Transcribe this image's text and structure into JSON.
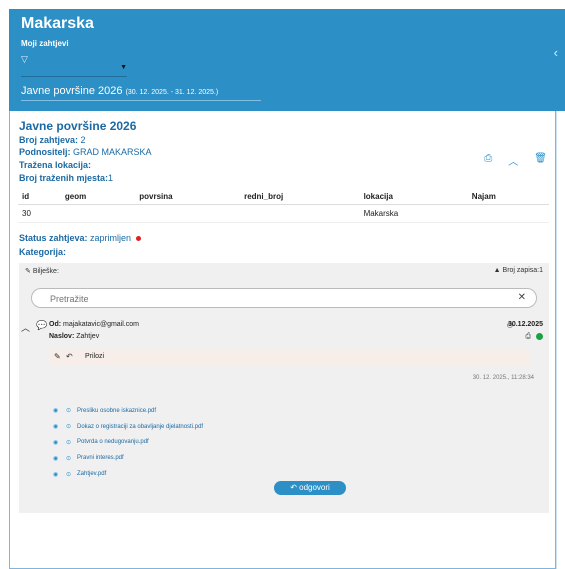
{
  "header": {
    "title": "Makarska",
    "subtitle": "Moji zahtjevi",
    "filter_icon": "filter-icon",
    "select_value": "",
    "collapse_icon": "chevron-left-icon",
    "range_title": "Javne površine 2026",
    "range_dates": "(30. 12. 2025. - 31. 12. 2025.)"
  },
  "request": {
    "title": "Javne površine 2026",
    "broj_label": "Broj zahtjeva:",
    "broj_value": "2",
    "podnositelj_label": "Podnositelj:",
    "podnositelj_value": "GRAD MAKARSKA",
    "lokacija_label": "Tražena lokacija:",
    "mjesta_label": "Broj traženih mjesta:",
    "mjesta_value": "1",
    "status_label": "Status zahtjeva:",
    "status_value": "zaprimljen",
    "kategorija_label": "Kategorija:"
  },
  "table": {
    "headers": [
      "id",
      "geom",
      "povrsina",
      "redni_broj",
      "lokacija",
      "Najam"
    ],
    "rows": [
      [
        "30",
        "",
        "",
        "",
        "Makarska",
        ""
      ]
    ]
  },
  "notes": {
    "title": "Bilješke:",
    "count_label": "Broj zapisa:1",
    "search_placeholder": "Pretražite",
    "from_label": "Od:",
    "from_value": "majakatavic@gmail.com",
    "date": "30.12.2025",
    "subject_label": "Naslov:",
    "subject_value": "Zahtjev",
    "prilozi_label": "Prilozi",
    "timestamp": "30. 12. 2025., 11:28:34",
    "attachments": [
      "Presliku osobne iskaznice.pdf",
      "Dokaz o registraciji za obavljanje djelatnosti.pdf",
      "Potvrda o nedugovanju.pdf",
      "Pravni interes.pdf",
      "Zahtjev.pdf"
    ],
    "reply_label": "odgovori"
  },
  "colors": {
    "accent": "#2c8fc6",
    "text_blue": "#1c6aa3",
    "status_dot": "#e02020",
    "ok": "#1aa341"
  }
}
